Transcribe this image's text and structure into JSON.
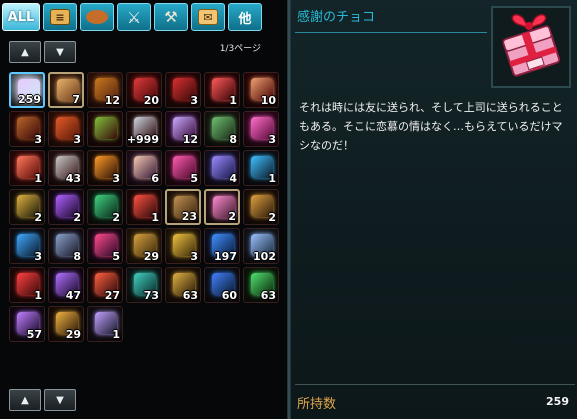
{
  "tabs": [
    {
      "label": "ALL",
      "icon": "all"
    },
    {
      "label": "",
      "icon": "scroll-icon"
    },
    {
      "label": "",
      "icon": "bread-icon"
    },
    {
      "label": "",
      "icon": "sword-icon"
    },
    {
      "label": "",
      "icon": "hammer-icon"
    },
    {
      "label": "",
      "icon": "letter-icon"
    },
    {
      "label": "他",
      "icon": "other"
    }
  ],
  "pager": {
    "page_label": "1/3ページ"
  },
  "inventory": {
    "items": [
      {
        "icon": "chocolate-gift-icon",
        "qty": "259",
        "bg": "#cde7f2",
        "fg": "#e7c9ff"
      },
      {
        "icon": "bread-basket-icon",
        "qty": "7",
        "bg": "#6a3a1c",
        "fg": "#e9b36a"
      },
      {
        "icon": "treasure-chest-icon",
        "qty": "12",
        "bg": "#5a2410",
        "fg": "#c87a1e"
      },
      {
        "icon": "red-candy-icon",
        "qty": "20",
        "bg": "#4a0808",
        "fg": "#e03a3a"
      },
      {
        "icon": "potion-bottle-icon",
        "qty": "3",
        "bg": "#3a0a0a",
        "fg": "#d83030"
      },
      {
        "icon": "red-bowl-icon",
        "qty": "1",
        "bg": "#3a0505",
        "fg": "#ff5a5a"
      },
      {
        "icon": "cookies-icon",
        "qty": "10",
        "bg": "#4a0505",
        "fg": "#f0a070"
      },
      {
        "icon": "bread-loaf-icon",
        "qty": "3",
        "bg": "#3a0a0a",
        "fg": "#b9652a"
      },
      {
        "icon": "book-icon",
        "qty": "3",
        "bg": "#5a1a08",
        "fg": "#e35a2a"
      },
      {
        "icon": "green-scroll-icon",
        "qty": "",
        "bg": "#3a0a0a",
        "fg": "#7fbf3a"
      },
      {
        "icon": "feather-icon",
        "qty": "+999",
        "bg": "#2a0a0a",
        "fg": "#cfd4e0"
      },
      {
        "icon": "sword-icon",
        "qty": "12",
        "bg": "#3a0a3a",
        "fg": "#c9a9ff"
      },
      {
        "icon": "green-chest-icon",
        "qty": "8",
        "bg": "#1a2a1a",
        "fg": "#6fbf6f"
      },
      {
        "icon": "pink-box-icon",
        "qty": "3",
        "bg": "#5a0a3a",
        "fg": "#ff6fc9"
      },
      {
        "icon": "red-envelope-icon",
        "qty": "1",
        "bg": "#5a0a0a",
        "fg": "#ff7a5a"
      },
      {
        "icon": "silver-medal-icon",
        "qty": "43",
        "bg": "#3a1a1a",
        "fg": "#c8c8c8"
      },
      {
        "icon": "campfire-icon",
        "qty": "3",
        "bg": "#2a1205",
        "fg": "#ff9a2a"
      },
      {
        "icon": "card-pack-icon",
        "qty": "6",
        "bg": "#3a1a3a",
        "fg": "#f3c8b0"
      },
      {
        "icon": "pink-ticket-icon",
        "qty": "5",
        "bg": "#4a0a2a",
        "fg": "#ff5ab0"
      },
      {
        "icon": "purple-chest-icon",
        "qty": "4",
        "bg": "#1a1a4a",
        "fg": "#9a8aff"
      },
      {
        "icon": "blue-capsule-icon",
        "qty": "1",
        "bg": "#0a1a2a",
        "fg": "#40c0ff"
      },
      {
        "icon": "gold-capsule-icon",
        "qty": "2",
        "bg": "#1a1a0a",
        "fg": "#e0b040"
      },
      {
        "icon": "purple-capsule-icon",
        "qty": "2",
        "bg": "#1a0a2a",
        "fg": "#b060ff"
      },
      {
        "icon": "green-capsule-icon",
        "qty": "2",
        "bg": "#0a2a1a",
        "fg": "#40d080"
      },
      {
        "icon": "red-capsule-icon",
        "qty": "1",
        "bg": "#2a0a0a",
        "fg": "#ff5040"
      },
      {
        "icon": "wooden-chest-icon",
        "qty": "23",
        "bg": "#3a2410",
        "fg": "#c09050"
      },
      {
        "icon": "pink-gift-box-icon",
        "qty": "2",
        "bg": "#3a1a2a",
        "fg": "#ff8ad0"
      },
      {
        "icon": "gold-capsule-icon",
        "qty": "2",
        "bg": "#2a1a0a",
        "fg": "#e0a040"
      },
      {
        "icon": "blue-capsule-icon",
        "qty": "3",
        "bg": "#0a1a2a",
        "fg": "#40a8ff"
      },
      {
        "icon": "mailbox-icon",
        "qty": "8",
        "bg": "#1a1a2a",
        "fg": "#8aa0c8"
      },
      {
        "icon": "treasure-box-icon",
        "qty": "5",
        "bg": "#2a0a2a",
        "fg": "#ff4a8a"
      },
      {
        "icon": "gold-chest-icon",
        "qty": "29",
        "bg": "#3a2a0a",
        "fg": "#d8a040"
      },
      {
        "icon": "gold-ticket-icon",
        "qty": "3",
        "bg": "#3a2a0a",
        "fg": "#f0c040"
      },
      {
        "icon": "blue-ticket-icon",
        "qty": "197",
        "bg": "#0a1a3a",
        "fg": "#4090ff"
      },
      {
        "icon": "ticket-icon",
        "qty": "102",
        "bg": "#1a2a3a",
        "fg": "#9ac0ff"
      },
      {
        "icon": "red-ticket-icon",
        "qty": "1",
        "bg": "#3a0a0a",
        "fg": "#ff4040"
      },
      {
        "icon": "purple-capsule-icon",
        "qty": "47",
        "bg": "#1a0a2a",
        "fg": "#b070ff"
      },
      {
        "icon": "red-capsule-icon",
        "qty": "27",
        "bg": "#2a0a0a",
        "fg": "#ff6040"
      },
      {
        "icon": "teal-capsule-icon",
        "qty": "73",
        "bg": "#0a2a2a",
        "fg": "#40d0c0"
      },
      {
        "icon": "gold-capsule-icon",
        "qty": "63",
        "bg": "#2a1a0a",
        "fg": "#e0b040"
      },
      {
        "icon": "blue-capsule-icon",
        "qty": "60",
        "bg": "#0a1a2a",
        "fg": "#4080ff"
      },
      {
        "icon": "green-capsule-icon",
        "qty": "63",
        "bg": "#0a2a0a",
        "fg": "#50e070"
      },
      {
        "icon": "purple-capsule-icon",
        "qty": "57",
        "bg": "#1a0a2a",
        "fg": "#c080ff"
      },
      {
        "icon": "gold-capsule-icon",
        "qty": "29",
        "bg": "#2a1a0a",
        "fg": "#f0b040"
      },
      {
        "icon": "lavender-card-icon",
        "qty": "1",
        "bg": "#1a1a2a",
        "fg": "#c0a0ff"
      }
    ]
  },
  "detail": {
    "name": "感謝のチョコ",
    "description": "それは時には友に送られ、そして上司に送られることもある。そこに恋慕の情はなく…もらえているだけマシなのだ！",
    "owned_label": "所持数",
    "owned_count": "259",
    "image_icon": "chocolate-gift-box-icon"
  }
}
